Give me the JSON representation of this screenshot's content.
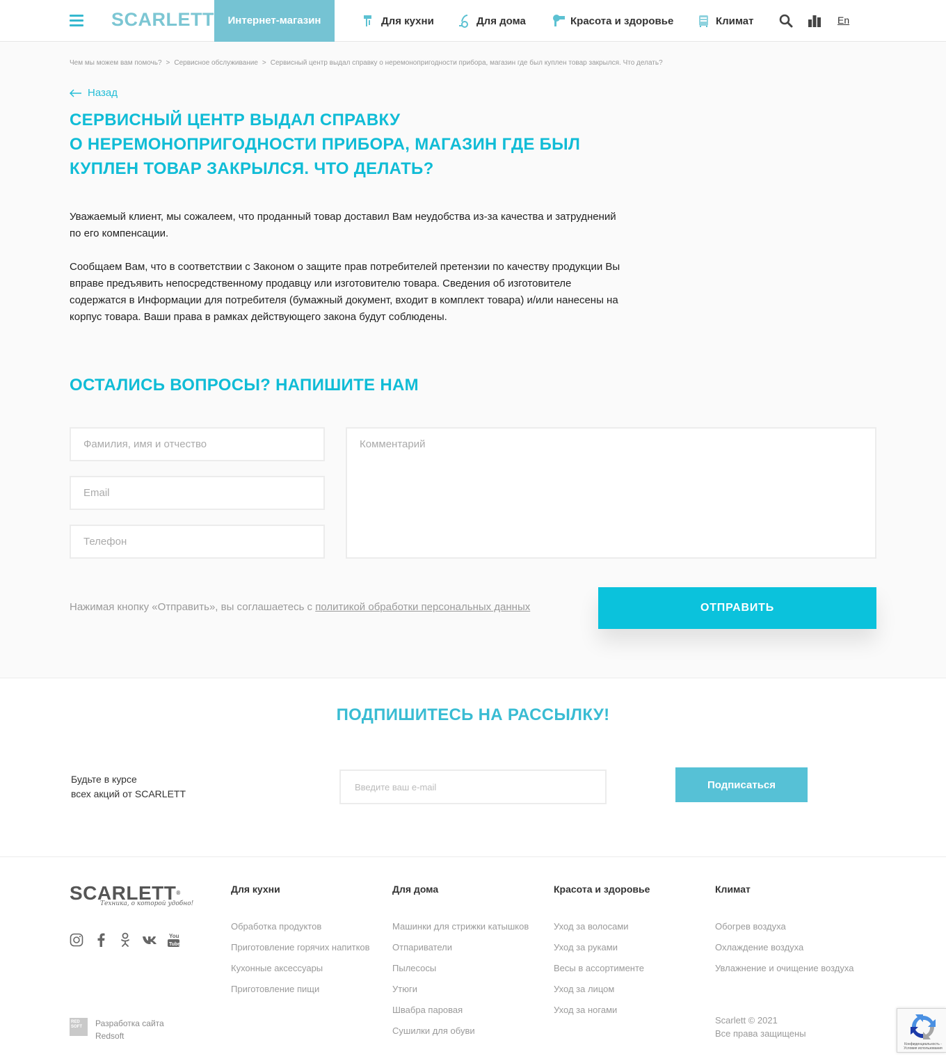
{
  "header": {
    "logo": "SCARLETT",
    "logo_mark": "®",
    "shop_tab": "Интернет-магазин",
    "nav": [
      {
        "label": "Для кухни",
        "icon": "mixer-icon"
      },
      {
        "label": "Для дома",
        "icon": "vacuum-icon"
      },
      {
        "label": "Красота и здоровье",
        "icon": "hairdryer-icon"
      },
      {
        "label": "Климат",
        "icon": "heater-icon"
      }
    ],
    "lang": "En",
    "accent_color": "#10bcd6",
    "tab_color": "#75c3d3"
  },
  "breadcrumb": [
    "Чем мы можем вам помочь?",
    "Сервисное обслуживание",
    "Сервисный центр выдал справку о неремонопригодности прибора, магазин где был куплен товар закрылся. Что делать?"
  ],
  "breadcrumb_sep": ">",
  "back_label": "Назад",
  "title_lines": [
    "Сервисный центр выдал справку",
    "о неремонопригодности прибора, магазин где был",
    "куплен товар закрылся. Что делать?"
  ],
  "paragraph1": [
    "Уважаемый клиент, мы сожалеем, что проданный товар доставил Вам неудобства из-за качества и затруднений",
    "по его компенсации."
  ],
  "paragraph2": [
    "Сообщаем Вам, что в соответствии с Законом о защите прав потребителей претензии по качеству продукции Вы",
    "вправе предъявить непосредственному продавцу или изготовителю товара. Сведения об изготовителе",
    "содержатся в Информации для потребителя (бумажный документ, входит в комплект товара) и/или нанесены на",
    "корпус товара. Ваши права в рамках действующего закона будут соблюдены."
  ],
  "form": {
    "title": "Остались вопросы? Напишите нам",
    "name_placeholder": "Фамилия, имя и отчество",
    "email_placeholder": "Email",
    "phone_placeholder": "Телефон",
    "comment_placeholder": "Комментарий",
    "consent_text": "Нажимая кнопку «Отправить», вы соглашаетесь с ",
    "consent_link": "политикой обработки персональных данных",
    "submit_label": "ОТПРАВИТЬ"
  },
  "newsletter": {
    "title": "Подпишитесь на рассылку!",
    "text_line1": "Будьте в курсе",
    "text_line2": "всех акций от SCARLETT",
    "input_placeholder": "Введите ваш e-mail",
    "button_label": "Подписаться"
  },
  "footer": {
    "logo": "SCARLETT",
    "logo_mark": "®",
    "slogan": "Техника, о которой удобно!",
    "social": [
      "instagram-icon",
      "facebook-icon",
      "odnoklassniki-icon",
      "vk-icon",
      "youtube-icon"
    ],
    "columns": [
      {
        "title": "Для кухни",
        "items": [
          "Обработка продуктов",
          "Приготовление горячих напитков",
          "Кухонные аксессуары",
          "Приготовление пищи"
        ]
      },
      {
        "title": "Для дома",
        "items": [
          "Машинки для стрижки катышков",
          "Отпариватели",
          "Пылесосы",
          "Утюги",
          "Швабра паровая",
          "Сушилки для обуви"
        ]
      },
      {
        "title": "Красота и здоровье",
        "items": [
          "Уход за волосами",
          "Уход за руками",
          "Весы в ассортименте",
          "Уход за лицом",
          "Уход за ногами"
        ]
      },
      {
        "title": "Климат",
        "items": [
          "Обогрев воздуха",
          "Охлаждение воздуха",
          "Увлажнение и очищение воздуха"
        ]
      }
    ],
    "dev_logo": "RED SOFT",
    "dev_line1": "Разработка сайта",
    "dev_line2": "Redsoft",
    "copy_line1": "Scarlett © 2021",
    "copy_line2": "Все права защищены",
    "recaptcha_text": "Конфиденциальность - Условия использования"
  }
}
